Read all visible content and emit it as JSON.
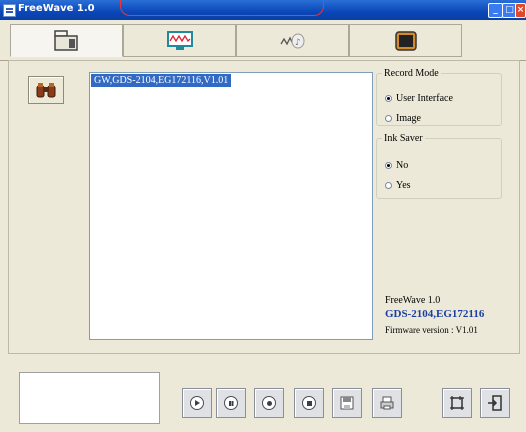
{
  "window": {
    "title": "FreeWave 1.0",
    "min_glyph": "_",
    "max_glyph": "□",
    "close_glyph": "×"
  },
  "tabs": [
    {
      "icon": "save-device-icon",
      "active": true
    },
    {
      "icon": "waveform-monitor-icon",
      "active": false
    },
    {
      "icon": "signal-music-icon",
      "active": false
    },
    {
      "icon": "device-screen-icon",
      "active": false
    }
  ],
  "device_list": {
    "items": [
      "GW,GDS-2104,EG172116,V1.01"
    ]
  },
  "record_mode": {
    "label": "Record Mode",
    "options": [
      "User Interface",
      "Image"
    ],
    "selected": "User Interface"
  },
  "ink_saver": {
    "label": "Ink Saver",
    "options": [
      "No",
      "Yes"
    ],
    "selected": "No"
  },
  "info": {
    "app_name": "FreeWave 1.0",
    "model": "GDS-2104,EG172116",
    "firmware": "Firmware version : V1.01"
  },
  "toolbar": {
    "buttons": [
      "play-icon",
      "pause-icon",
      "record-icon",
      "stop-icon",
      "save-icon",
      "print-icon"
    ],
    "right_buttons": [
      "fit-screen-icon",
      "exit-icon"
    ]
  },
  "colors": {
    "title_bar": "#0a47b8",
    "selection": "#316ac5",
    "model_text": "#1a3ea5",
    "highlight": "#e2383a"
  }
}
